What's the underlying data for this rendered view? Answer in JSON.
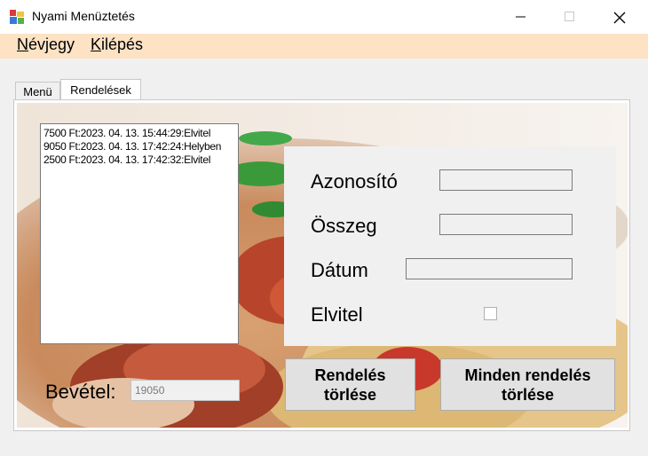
{
  "window": {
    "title": "Nyami Menüztetés"
  },
  "menubar": {
    "items": [
      {
        "label": "Névjegy",
        "accel": "N",
        "rest": "évjegy"
      },
      {
        "label": "Kilépés",
        "accel": "K",
        "rest": "ilépés"
      }
    ]
  },
  "tabs": [
    {
      "label": "Menü",
      "active": false
    },
    {
      "label": "Rendelések",
      "active": true
    }
  ],
  "orders": [
    "7500 Ft:2023. 04. 13. 15:44:29:Elvitel",
    "9050 Ft:2023. 04. 13. 17:42:24:Helyben",
    "2500 Ft:2023. 04. 13. 17:42:32:Elvitel"
  ],
  "details": {
    "id_label": "Azonosító",
    "id_value": "",
    "amount_label": "Összeg",
    "amount_value": "",
    "date_label": "Dátum",
    "date_value": "",
    "takeaway_label": "Elvitel",
    "takeaway_checked": false
  },
  "revenue": {
    "label": "Bevétel:",
    "value": "19050"
  },
  "buttons": {
    "delete_order": "Rendelés törlése",
    "delete_all": "Minden rendelés törlése"
  },
  "colors": {
    "menubar_bg": "#fde2c4",
    "window_bg": "#f0f0f0"
  }
}
